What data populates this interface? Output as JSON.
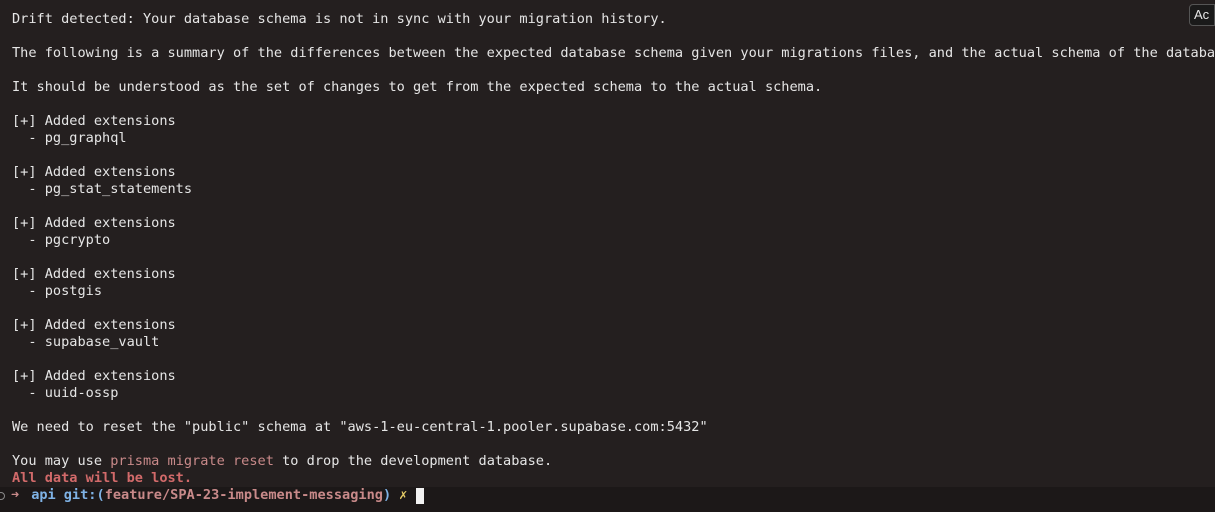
{
  "overlay": {
    "tab_label": "Ac"
  },
  "output": {
    "drift": "Drift detected: Your database schema is not in sync with your migration history.",
    "summary": "The following is a summary of the differences between the expected database schema given your migrations files, and the actual schema of the database.",
    "understood": "It should be understood as the set of changes to get from the expected schema to the actual schema.",
    "changes": [
      {
        "header": "[+] Added extensions",
        "item": "  - pg_graphql"
      },
      {
        "header": "[+] Added extensions",
        "item": "  - pg_stat_statements"
      },
      {
        "header": "[+] Added extensions",
        "item": "  - pgcrypto"
      },
      {
        "header": "[+] Added extensions",
        "item": "  - postgis"
      },
      {
        "header": "[+] Added extensions",
        "item": "  - supabase_vault"
      },
      {
        "header": "[+] Added extensions",
        "item": "  - uuid-ossp"
      }
    ],
    "reset_notice": "We need to reset the \"public\" schema at \"aws-1-eu-central-1.pooler.supabase.com:5432\"",
    "reset_hint_prefix": "You may use ",
    "reset_hint_command": "prisma migrate reset",
    "reset_hint_suffix": " to drop the development database.",
    "data_loss_warning": "All data will be lost."
  },
  "prompt": {
    "arrow": "➜",
    "directory": "api",
    "git_label": "git:",
    "open_paren": "(",
    "branch": "feature/SPA-23-implement-messaging",
    "close_paren": ")",
    "dirty_marker": "✗"
  }
}
